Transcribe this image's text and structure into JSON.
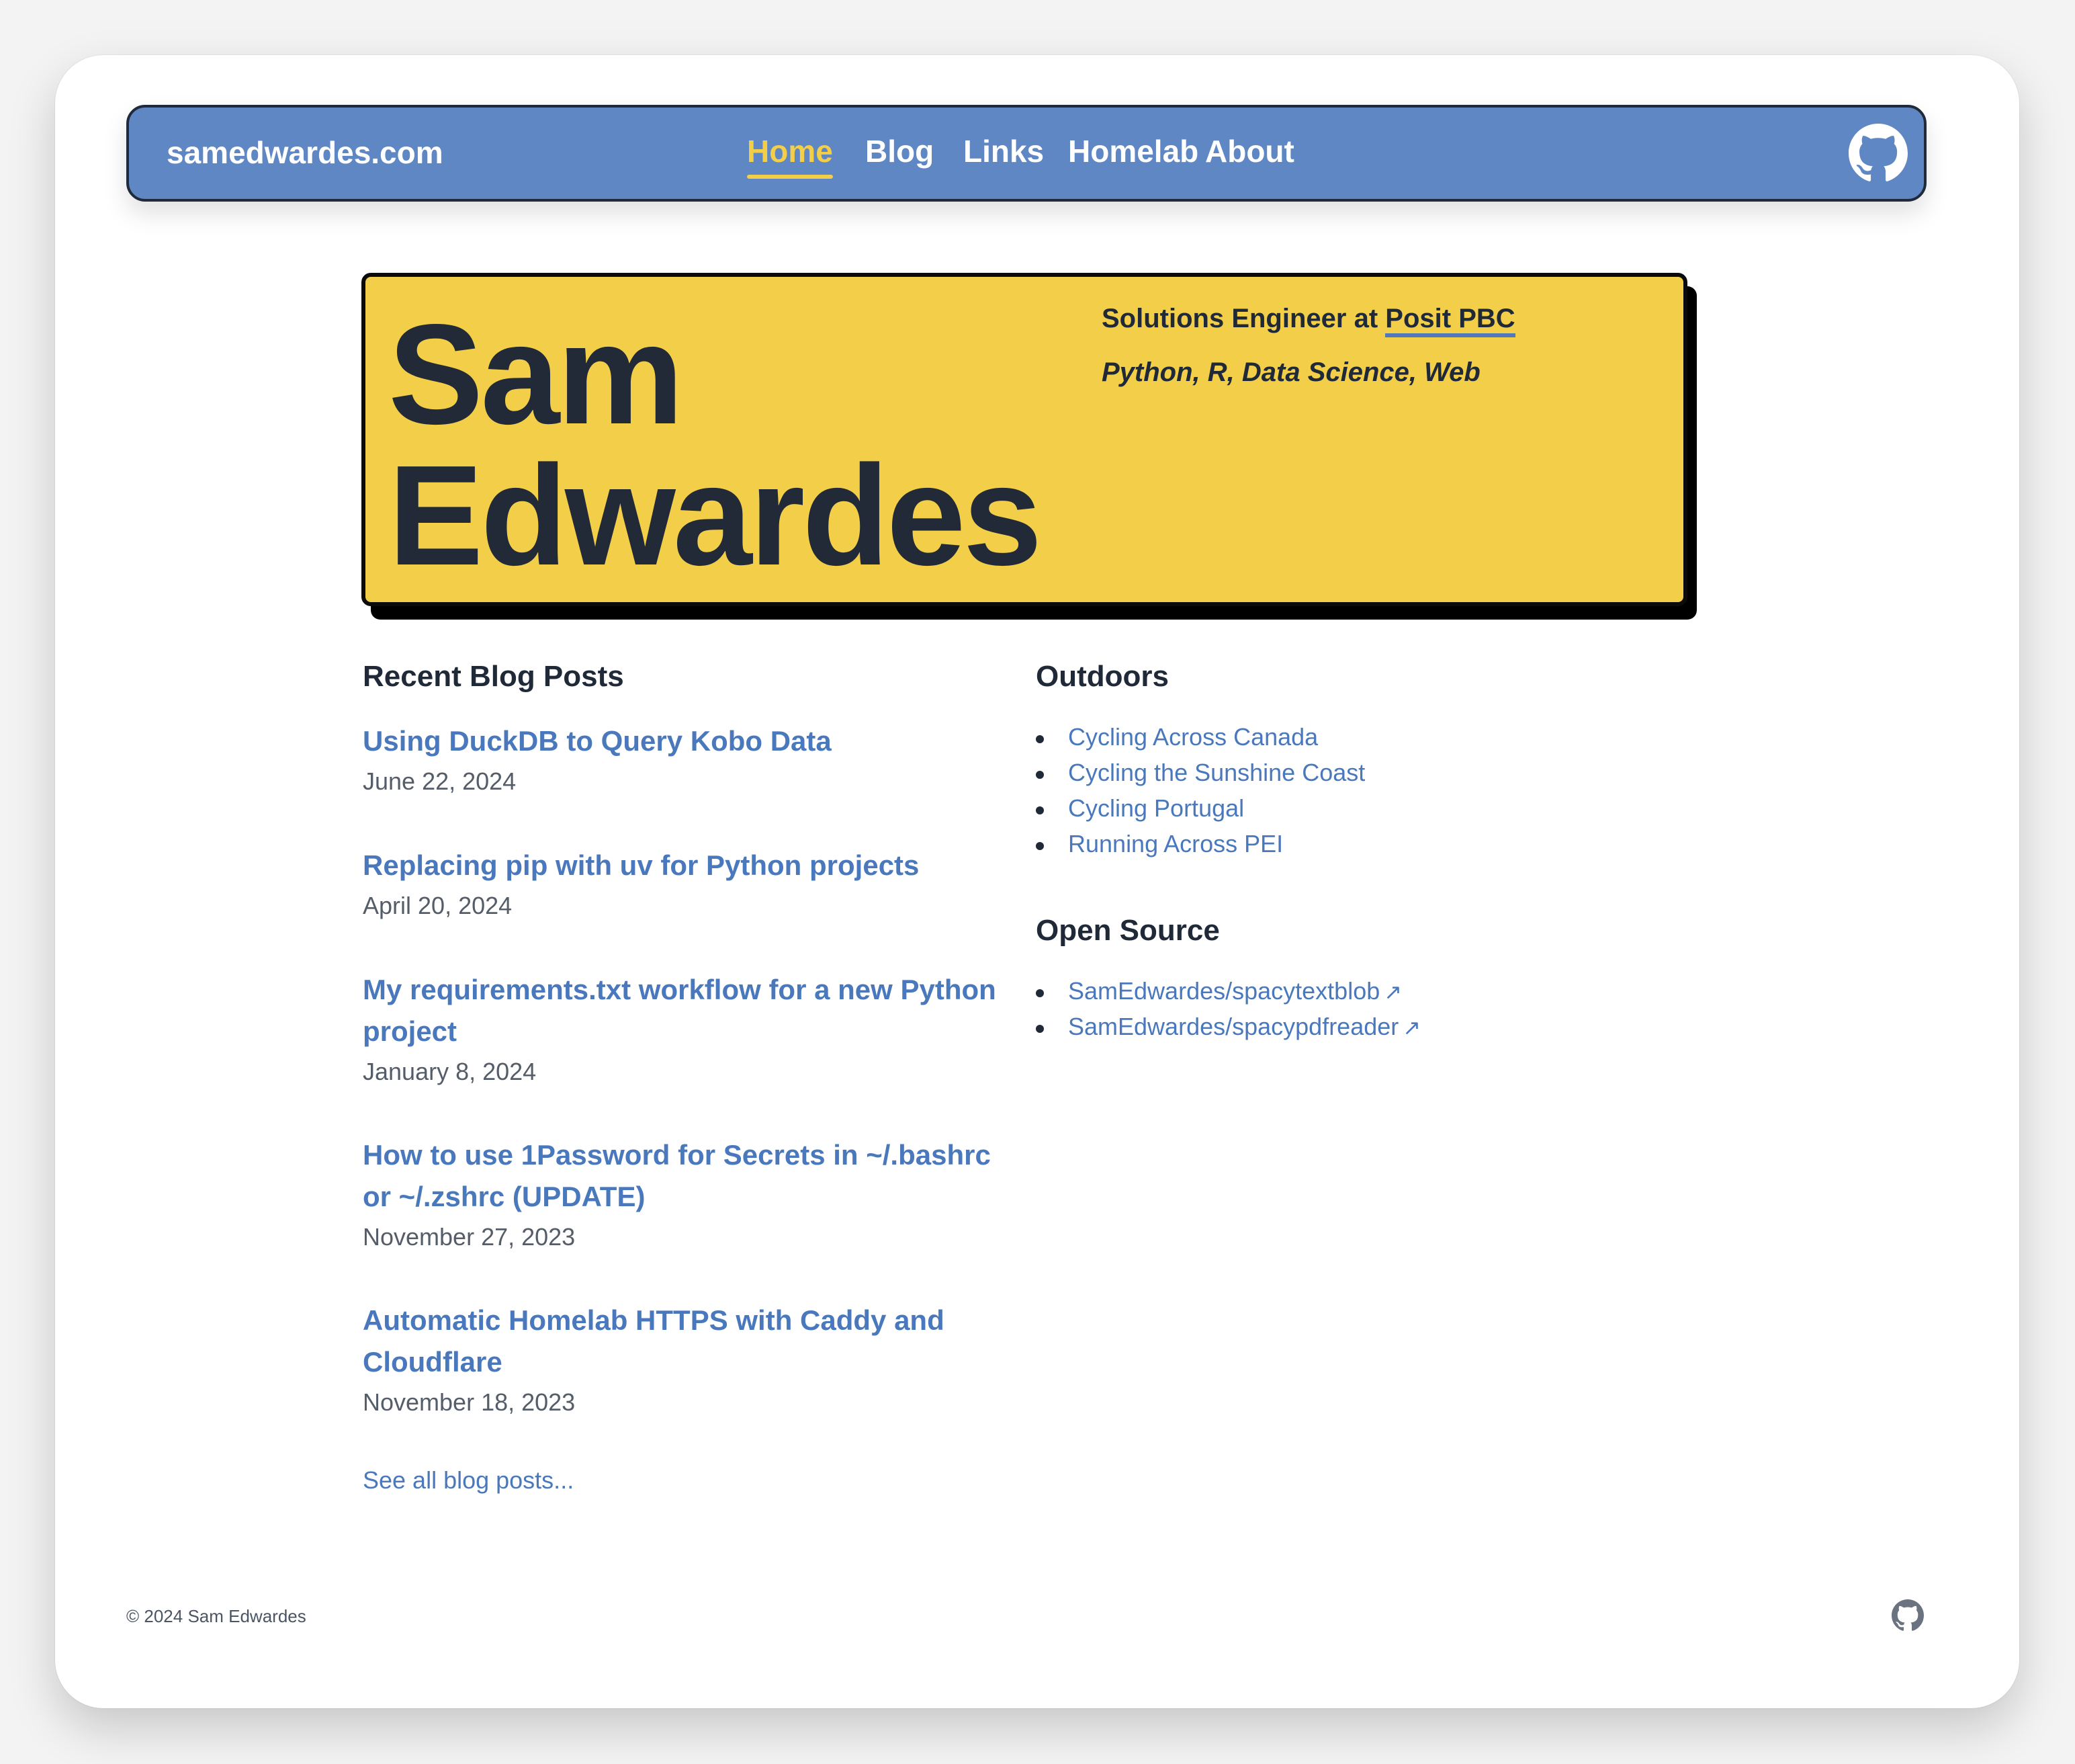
{
  "nav": {
    "site_title": "samedwardes.com",
    "links": [
      {
        "label": "Home",
        "active": true
      },
      {
        "label": "Blog",
        "active": false
      },
      {
        "label": "Links",
        "active": false
      },
      {
        "label": "Homelab",
        "active": false
      },
      {
        "label": "About",
        "active": false
      }
    ],
    "github_icon": "github-icon"
  },
  "hero": {
    "first_name": "Sam",
    "last_name": "Edwardes",
    "role_prefix": "Solutions Engineer at",
    "employer": "Posit PBC",
    "skills": "Python, R, Data Science, Web"
  },
  "blog": {
    "heading": "Recent Blog Posts",
    "posts": [
      {
        "title": "Using DuckDB to Query Kobo Data",
        "date": "June 22, 2024"
      },
      {
        "title": "Replacing pip with uv for Python projects",
        "date": "April 20, 2024"
      },
      {
        "title": "My requirements.txt workflow for a new Python project",
        "date": "January 8, 2024"
      },
      {
        "title": "How to use 1Password for Secrets in ~/.bashrc or ~/.zshrc (UPDATE)",
        "date": "November 27, 2023"
      },
      {
        "title": "Automatic Homelab HTTPS with Caddy and Cloudflare",
        "date": "November 18, 2023"
      }
    ],
    "see_all": "See all blog posts..."
  },
  "outdoors": {
    "heading": "Outdoors",
    "items": [
      "Cycling Across Canada",
      "Cycling the Sunshine Coast",
      "Cycling Portugal",
      "Running Across PEI"
    ]
  },
  "open_source": {
    "heading": "Open Source",
    "items": [
      "SamEdwardes/spacytextblob",
      "SamEdwardes/spacypdfreader"
    ],
    "external_glyph": "↗"
  },
  "footer": {
    "copyright": "© 2024 Sam Edwardes"
  },
  "colors": {
    "nav_bg": "#5e87c4",
    "accent_yellow": "#f2ce49",
    "link_blue": "#4a78bd",
    "text_dark": "#222a38"
  }
}
